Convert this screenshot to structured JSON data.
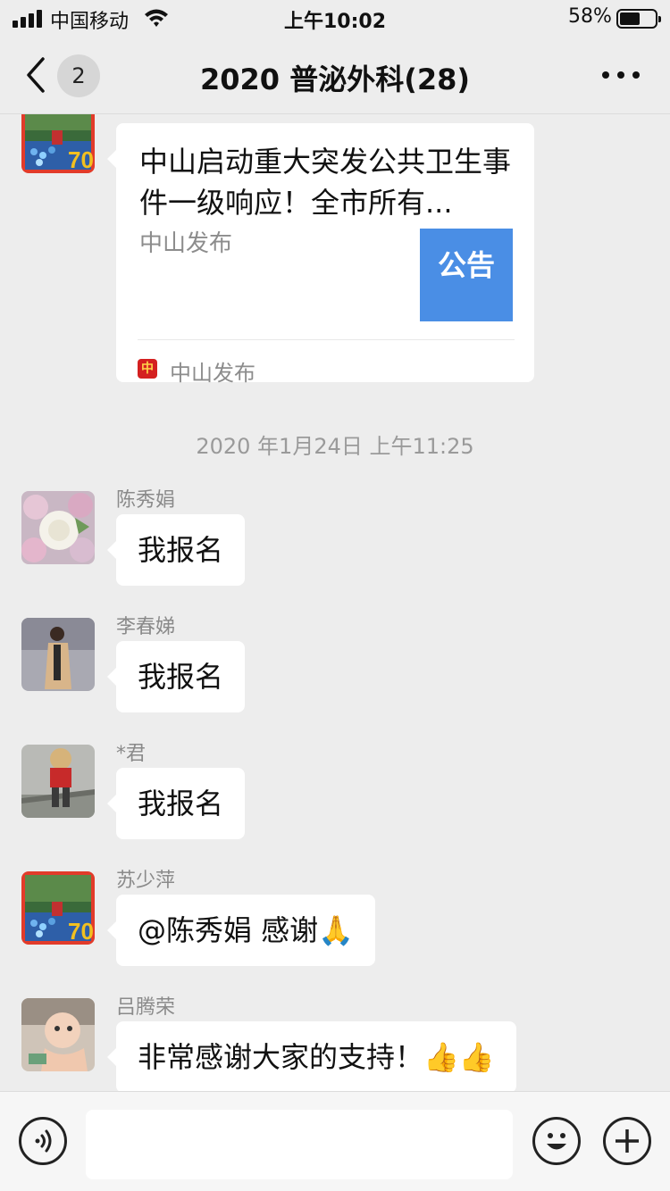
{
  "status_bar": {
    "carrier": "中国移动",
    "time": "上午10:02",
    "battery_percent_label": "58%",
    "battery_level": 0.58
  },
  "nav": {
    "back_icon": "chevron-left-icon",
    "unread_count": "2",
    "title": "2020 普泌外科(28)",
    "more_icon": "more-dots-icon"
  },
  "article_card": {
    "title": "中山启动重大突发公共卫生事件一级响应！全市所有...",
    "source": "中山发布",
    "thumbnail_text": "公告",
    "footer_source": "中山发布",
    "footer_icon_text": "中"
  },
  "timestamp": "2020 年1月24日 上午11:25",
  "messages": [
    {
      "sender": "陈秀娟",
      "text": "我报名",
      "avatar": "flowers"
    },
    {
      "sender": "李春娣",
      "text": "我报名",
      "avatar": "woman-coat"
    },
    {
      "sender": "*君",
      "text": "我报名",
      "avatar": "child"
    },
    {
      "sender": "苏少萍",
      "text": "@陈秀娟 感谢🙏",
      "avatar": "logo-70"
    },
    {
      "sender": "吕腾荣",
      "text": "非常感谢大家的支持！👍👍",
      "avatar": "baby"
    }
  ],
  "input_bar": {
    "voice_icon": "voice-icon",
    "emoji_icon": "emoji-icon",
    "plus_icon": "plus-icon",
    "placeholder": ""
  },
  "colors": {
    "background": "#ededed",
    "bubble": "#ffffff",
    "thumbnail": "#4a8ee5",
    "secondary_text": "#8a8a8a"
  }
}
